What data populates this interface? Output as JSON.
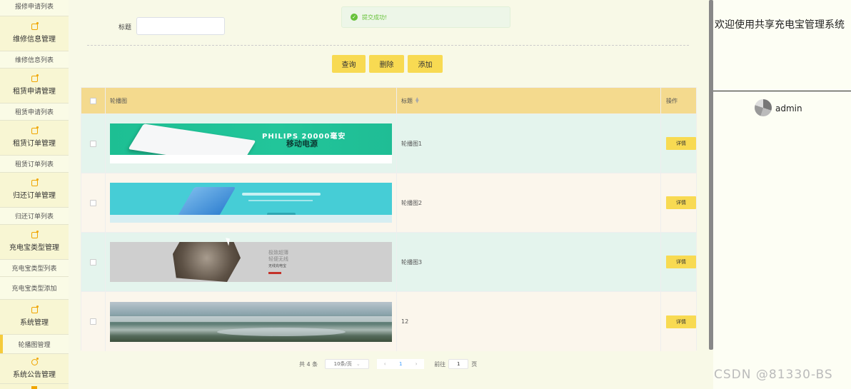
{
  "sidebar": {
    "items": [
      {
        "type": "sub",
        "label": "报修申请列表"
      },
      {
        "type": "group",
        "label": "维修信息管理"
      },
      {
        "type": "sub",
        "label": "维修信息列表"
      },
      {
        "type": "group",
        "label": "租赁申请管理"
      },
      {
        "type": "sub",
        "label": "租赁申请列表"
      },
      {
        "type": "group",
        "label": "租赁订单管理"
      },
      {
        "type": "sub",
        "label": "租赁订单列表"
      },
      {
        "type": "group",
        "label": "归还订单管理"
      },
      {
        "type": "sub",
        "label": "归还订单列表"
      },
      {
        "type": "group",
        "label": "充电宝类型管理"
      },
      {
        "type": "sub",
        "label": "充电宝类型列表"
      },
      {
        "type": "sub",
        "label": "充电宝类型添加"
      },
      {
        "type": "group",
        "label": "系统管理"
      },
      {
        "type": "sub",
        "label": "轮播图管理",
        "active": true
      },
      {
        "type": "group",
        "label": "系统公告管理"
      }
    ]
  },
  "search": {
    "label": "标题",
    "value": ""
  },
  "toast": {
    "message": "提交成功!"
  },
  "toolbar": {
    "query": "查询",
    "delete": "删除",
    "add": "添加"
  },
  "table": {
    "headers": {
      "image": "轮播图",
      "title": "标题",
      "actions": "操作"
    },
    "rows": [
      {
        "title": "轮播图1",
        "detail": "详情",
        "banner": {
          "line1": "PHILIPS 20000毫安",
          "line2": "移动电源"
        }
      },
      {
        "title": "轮播图2",
        "detail": "详情"
      },
      {
        "title": "轮播图3",
        "detail": "详情",
        "banner": {
          "lines": [
            "极致超薄",
            "轻便无线",
            "无线充电宝"
          ]
        }
      },
      {
        "title": "12",
        "detail": "详情"
      }
    ]
  },
  "pagination": {
    "total": "共 4 条",
    "page_size": "10条/页",
    "prev": "‹",
    "page": "1",
    "next": "›",
    "goto": "前往",
    "goto_value": "1",
    "page_unit": "页"
  },
  "header": {
    "welcome": "欢迎使用共享充电宝管理系统",
    "user": "admin"
  },
  "watermark": "CSDN @81330-BS",
  "colors": {
    "accent": "#f8da52",
    "header_row": "#f4da8e",
    "row_odd": "#e4f4ed",
    "row_even": "#fbf6ec",
    "success": "#67c23a"
  }
}
